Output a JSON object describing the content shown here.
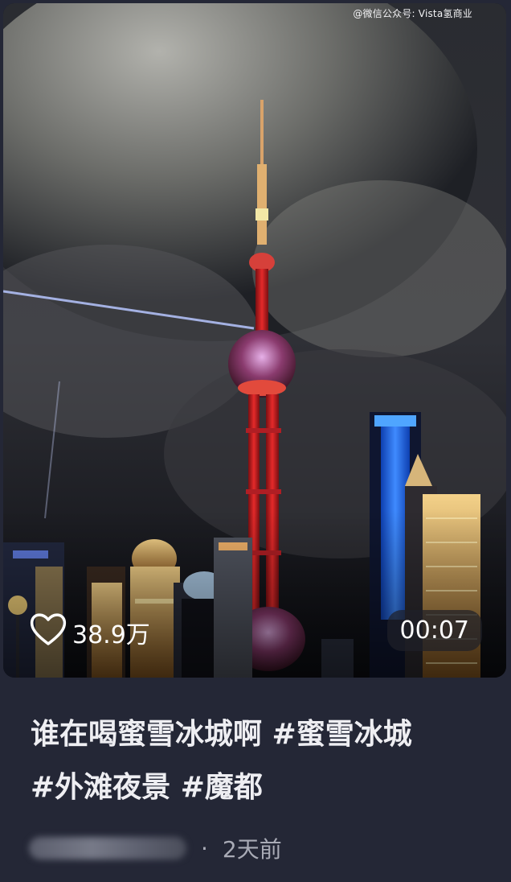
{
  "watermark": "@微信公众号: Vista氢商业",
  "video": {
    "likes": "38.9万",
    "duration": "00:07"
  },
  "caption": {
    "line1": "谁在喝蜜雪冰城啊 #蜜雪冰城",
    "line2": "#外滩夜景 #魔都"
  },
  "meta": {
    "separator": "·",
    "posted": "2天前"
  },
  "icons": {
    "like": "heart-icon"
  }
}
